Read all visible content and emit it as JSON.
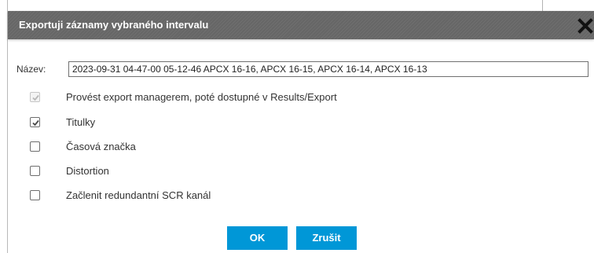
{
  "dialog": {
    "title": "Exportuji záznamy vybraného intervalu",
    "close_icon": "close-x-icon"
  },
  "name_field": {
    "label": "Název:",
    "value": "2023-09-31 04-47-00 05-12-46 APCX 16-16, APCX 16-15, APCX 16-14, APCX 16-13"
  },
  "options": [
    {
      "label": "Provést export managerem, poté dostupné v Results/Export",
      "checked": true,
      "disabled": true
    },
    {
      "label": "Titulky",
      "checked": true,
      "disabled": false
    },
    {
      "label": "Časová značka",
      "checked": false,
      "disabled": false
    },
    {
      "label": "Distortion",
      "checked": false,
      "disabled": false
    },
    {
      "label": "Začlenit redundantní SCR kanál",
      "checked": false,
      "disabled": false
    }
  ],
  "buttons": {
    "ok_label": "OK",
    "cancel_label": "Zrušit"
  },
  "colors": {
    "titlebar": "#6a6a6a",
    "button": "#0097d7",
    "checkmark": "#4a4a4a",
    "checkmark_disabled": "#b8b8b8"
  }
}
